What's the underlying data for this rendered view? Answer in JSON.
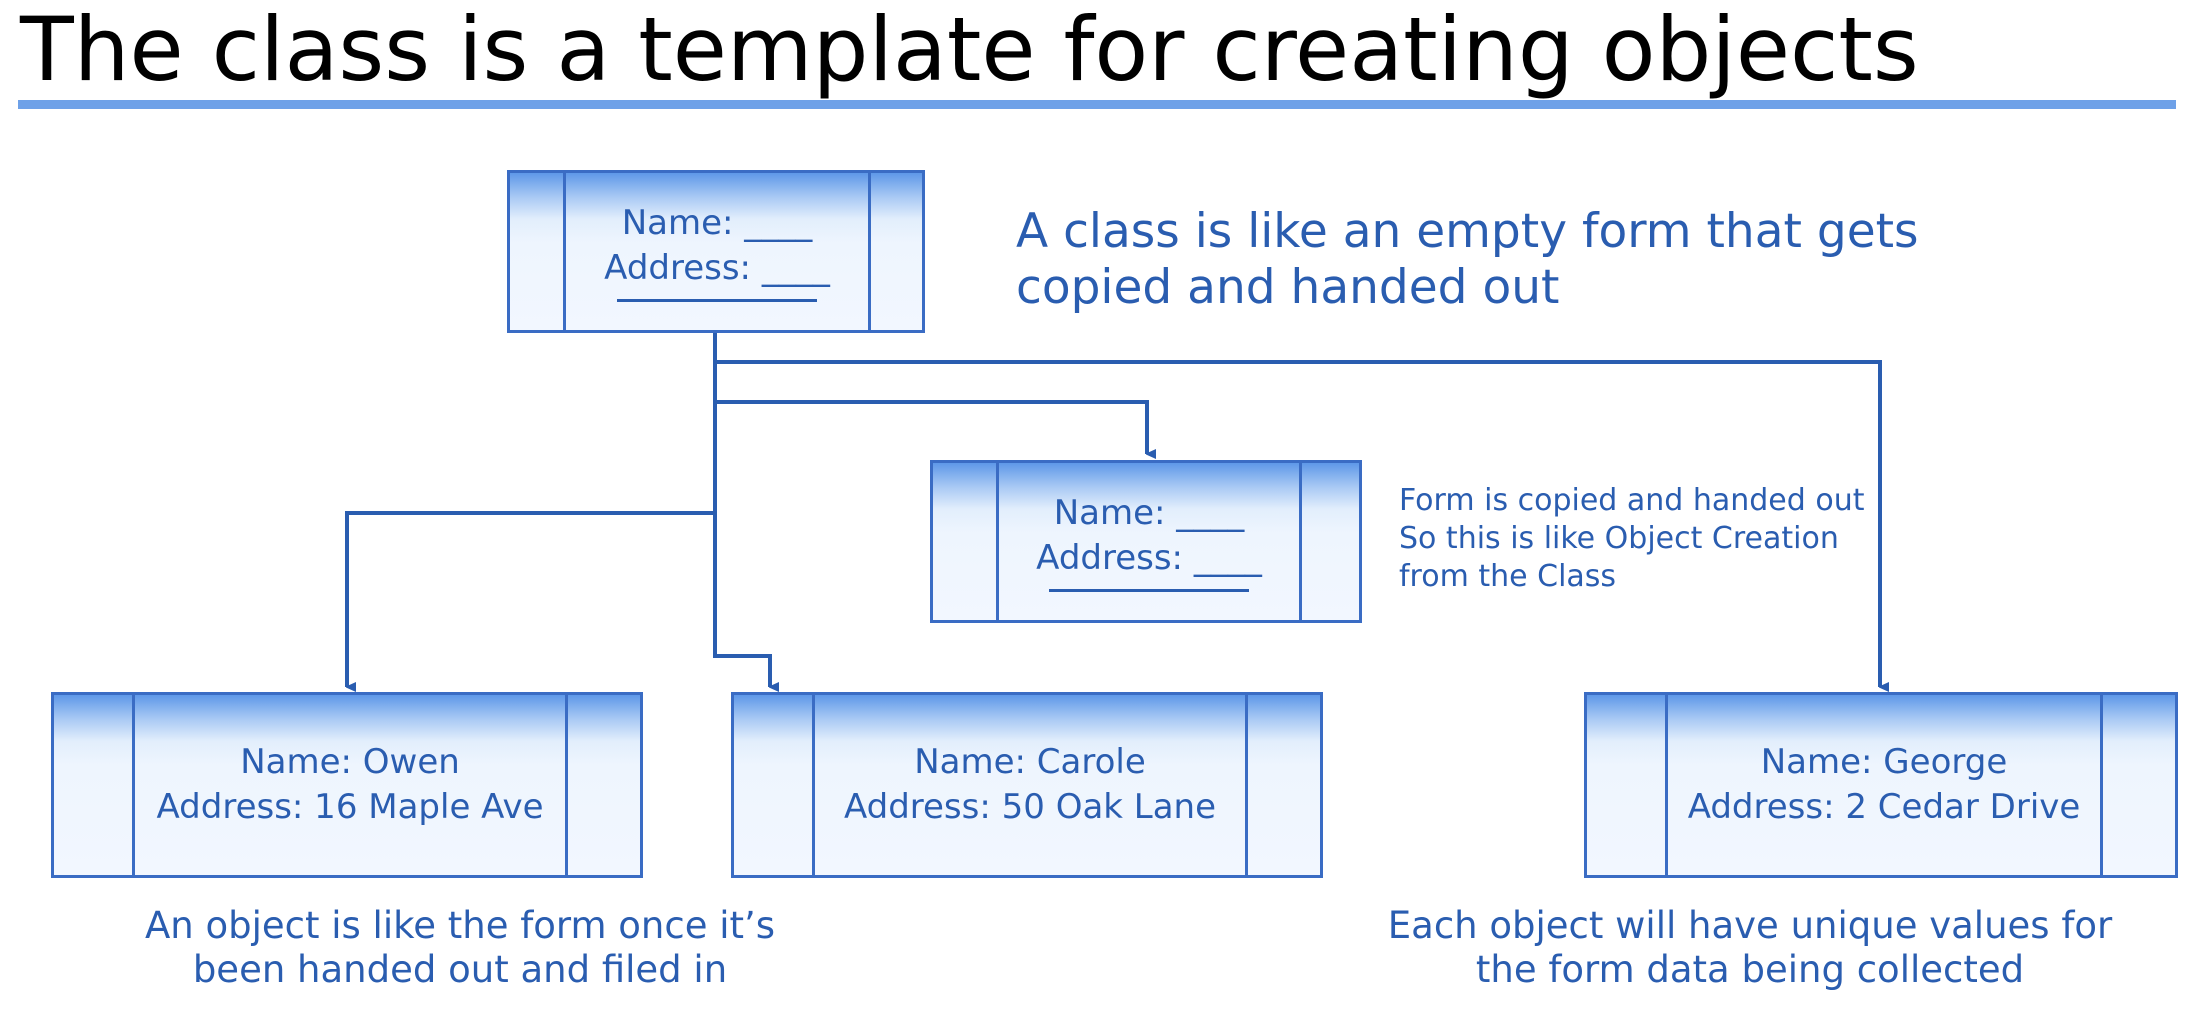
{
  "title": "The class is a template for creating objects",
  "class_form": {
    "name_label": "Name: ____",
    "address_label": "Address: ____"
  },
  "class_note": {
    "line1": "A class is like an empty form that gets",
    "line2": "copied and handed out"
  },
  "copy_form": {
    "name_label": "Name: ____",
    "address_label": "Address: ____"
  },
  "copy_note": {
    "line1": "Form is copied and handed out",
    "line2": "So this is like Object Creation",
    "line3": "from the Class"
  },
  "objects": [
    {
      "name": "Name: Owen",
      "address": "Address: 16 Maple Ave"
    },
    {
      "name": "Name: Carole",
      "address": "Address: 50 Oak Lane"
    },
    {
      "name": "Name: George",
      "address": "Address: 2 Cedar Drive"
    }
  ],
  "object_note": {
    "line1": "An object is like the form once it’s",
    "line2": "been handed out and filed in"
  },
  "unique_note": {
    "line1": "Each object will have unique values for",
    "line2": "the form data being collected"
  },
  "colors": {
    "accent": "#2a5db0",
    "rule": "#6ea1e8",
    "title": "#000000"
  }
}
